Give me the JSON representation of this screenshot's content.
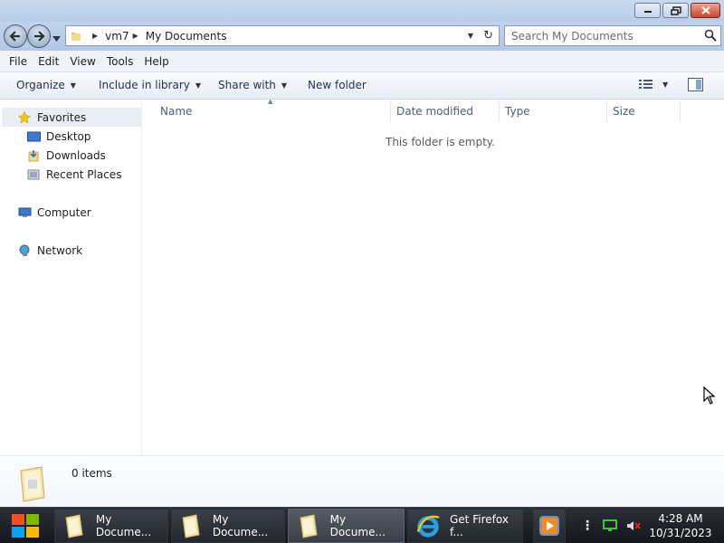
{
  "window": {
    "controls": {
      "minimize_icon": "minimize-icon",
      "restore_icon": "restore-icon",
      "close_icon": "close-icon"
    }
  },
  "address": {
    "breadcrumbs": [
      "vm7",
      "My Documents"
    ]
  },
  "search": {
    "placeholder": "Search My Documents"
  },
  "menu": [
    "File",
    "Edit",
    "View",
    "Tools",
    "Help"
  ],
  "commands": {
    "organize": "Organize",
    "include_in_library": "Include in library",
    "share_with": "Share with",
    "new_folder": "New folder"
  },
  "nav": {
    "favorites": "Favorites",
    "desktop": "Desktop",
    "downloads": "Downloads",
    "recent_places": "Recent Places",
    "computer": "Computer",
    "network": "Network"
  },
  "columns": [
    "Name",
    "Date modified",
    "Type",
    "Size"
  ],
  "content": {
    "empty_message": "This folder is empty."
  },
  "details": {
    "item_count": "0 items"
  },
  "taskbar": {
    "buttons": [
      {
        "label": "My Docume...",
        "icon": "folder-icon",
        "active": false
      },
      {
        "label": "My Docume...",
        "icon": "folder-icon",
        "active": false
      },
      {
        "label": "My Docume...",
        "icon": "folder-icon",
        "active": true
      },
      {
        "label": "Get Firefox f...",
        "icon": "internet-explorer-icon",
        "active": false
      }
    ],
    "clock": {
      "time": "4:28 AM",
      "date": "10/31/2023"
    }
  },
  "colors": {
    "titlebar": "#c0d3ec",
    "taskbar": "#1e2228",
    "close_button": "#c9462c",
    "selection": "#eaeef3"
  }
}
